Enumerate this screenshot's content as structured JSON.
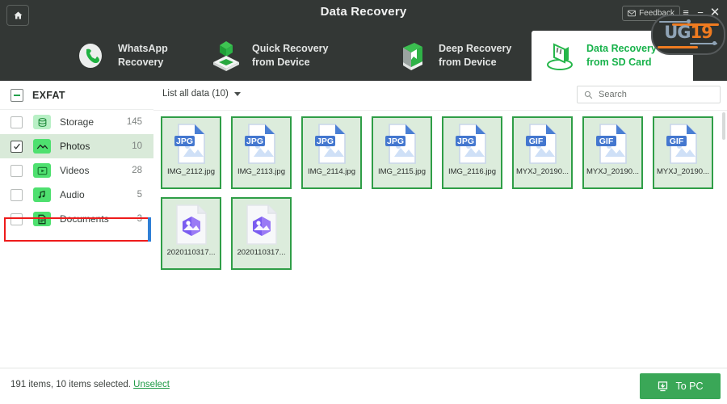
{
  "window": {
    "title": "Data Recovery",
    "home_icon": "home-icon",
    "feedback_label": "Feedback",
    "feedback_icon": "mail-icon",
    "minimize_label": "≡",
    "restore_label": "−",
    "close_label": "✕"
  },
  "watermark": {
    "text_left": "UG",
    "text_right": "19",
    "color_blue": "#8fa3b5",
    "color_orange": "#ef7b20"
  },
  "tabs": [
    {
      "id": "whatsapp-recovery",
      "line1": "WhatsApp",
      "line2": "Recovery",
      "icon": "whatsapp-phone-icon",
      "active": false
    },
    {
      "id": "quick-recovery-device",
      "line1": "Quick Recovery",
      "line2": "from Device",
      "icon": "device-cube-icon",
      "active": false
    },
    {
      "id": "deep-recovery-device",
      "line1": "Deep Recovery",
      "line2": "from Device",
      "icon": "deep-scan-box-icon",
      "active": false
    },
    {
      "id": "data-recovery-sd-card",
      "line1": "Data Recovery",
      "line2": "from SD Card",
      "icon": "sd-card-icon",
      "active": true
    }
  ],
  "sidebar": {
    "header_label": "EXFAT",
    "collapse_icon": "minus-square-icon",
    "items": [
      {
        "id": "storage",
        "label": "Storage",
        "count": "145",
        "icon": "database-icon",
        "checked": false,
        "selected": false
      },
      {
        "id": "photos",
        "label": "Photos",
        "count": "10",
        "icon": "photo-icon",
        "checked": true,
        "selected": true
      },
      {
        "id": "videos",
        "label": "Videos",
        "count": "28",
        "icon": "video-icon",
        "checked": false,
        "selected": false
      },
      {
        "id": "audio",
        "label": "Audio",
        "count": "5",
        "icon": "music-icon",
        "checked": false,
        "selected": false
      },
      {
        "id": "documents",
        "label": "Documents",
        "count": "3",
        "icon": "document-icon",
        "checked": false,
        "selected": false
      }
    ]
  },
  "toolbar": {
    "filter_label": "List all data (10)",
    "filter_caret_icon": "chevron-down-icon",
    "search_placeholder": "Search",
    "search_value": "",
    "search_icon": "search-icon"
  },
  "files": [
    {
      "name": "IMG_2112.jpg",
      "badge": "JPG",
      "type": "jpg",
      "selected": true
    },
    {
      "name": "IMG_2113.jpg",
      "badge": "JPG",
      "type": "jpg",
      "selected": true
    },
    {
      "name": "IMG_2114.jpg",
      "badge": "JPG",
      "type": "jpg",
      "selected": true
    },
    {
      "name": "IMG_2115.jpg",
      "badge": "JPG",
      "type": "jpg",
      "selected": true
    },
    {
      "name": "IMG_2116.jpg",
      "badge": "JPG",
      "type": "jpg",
      "selected": true
    },
    {
      "name": "MYXJ_20190...",
      "badge": "GIF",
      "type": "gif",
      "selected": true
    },
    {
      "name": "MYXJ_20190...",
      "badge": "GIF",
      "type": "gif",
      "selected": true
    },
    {
      "name": "MYXJ_20190...",
      "badge": "GIF",
      "type": "gif",
      "selected": true
    },
    {
      "name": "2020110317...",
      "badge": "",
      "type": "image",
      "selected": true
    },
    {
      "name": "2020110317...",
      "badge": "",
      "type": "image",
      "selected": true
    }
  ],
  "footer": {
    "status_text": "191 items, 10 items selected.",
    "unselect_label": "Unselect",
    "to_pc_label": "To PC",
    "to_pc_icon": "download-to-device-icon"
  },
  "colors": {
    "header_bg": "#333735",
    "accent_green": "#18b24b",
    "button_green": "#3aa757",
    "card_border": "#2f9e47",
    "card_bg": "#dcecdc",
    "highlight_red": "#ee1b1b",
    "highlight_blue": "#2f7fd6"
  }
}
